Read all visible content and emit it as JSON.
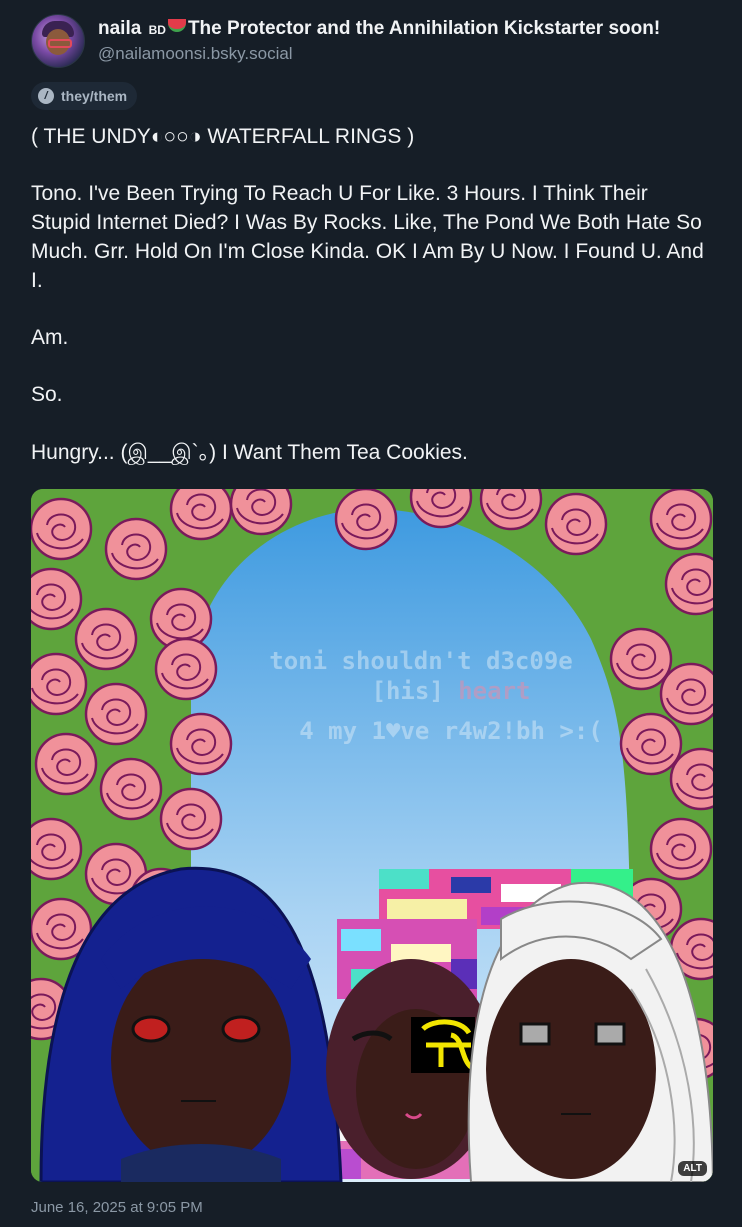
{
  "post": {
    "author": {
      "display_name": "naila",
      "name_badge": "BD",
      "name_rest": "The Protector and the Annihilation Kickstarter soon!",
      "handle": "@nailamoonsi.bsky.social",
      "avatar_icon": "avatar-image"
    },
    "pronouns": "they/them",
    "body": {
      "line1": "( THE UNDY◐○○◑ WATERFALL RINGS )",
      "para2": "Tono. I've Been Trying To Reach U For Like. 3 Hours. I Think Their Stupid Internet Died? I Was By Rocks. Like, The Pond We Both Hate So Much. Grr. Hold On I'm Close Kinda. OK I Am By U Now. I Found U. And I.",
      "para3": "Am.",
      "para4": "So.",
      "para5": "Hungry...  (இ__இ`。) I Want Them Tea Cookies."
    },
    "image": {
      "overlay_line1": "toni shouldn't d3c09e",
      "overlay_line2a": "[his]",
      "overlay_line2b": "heart",
      "overlay_line3": "4 my 1♥ve r4w2!bh >:(",
      "alt_badge": "ALT"
    },
    "timestamp": "June 16, 2025 at 9:05 PM",
    "colors": {
      "background": "#161e27",
      "text": "#f1f3f5",
      "muted": "#8b98a5",
      "rose": "#f0919a",
      "rose_outline": "#7a1a5b",
      "sky": "#4aa3e0",
      "grass": "#5ea43c"
    }
  }
}
